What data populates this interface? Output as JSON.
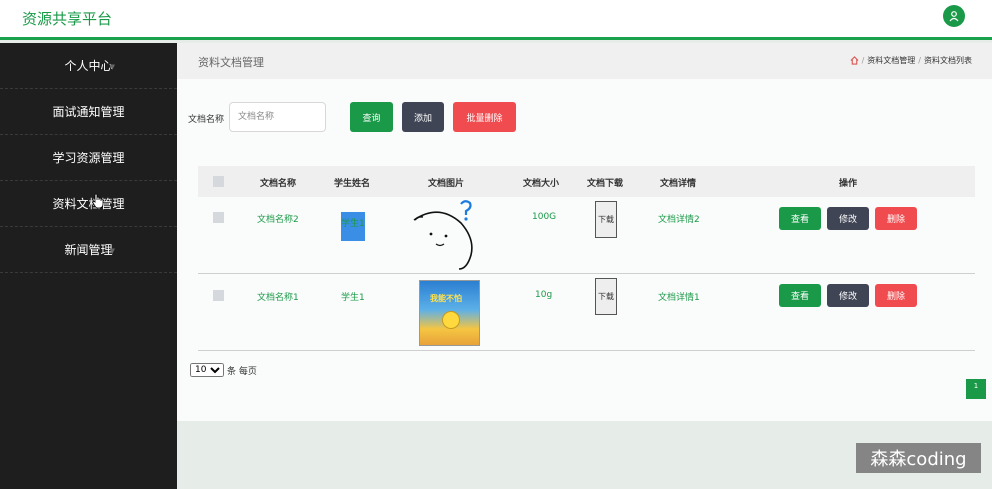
{
  "app": {
    "title": "资源共享平台"
  },
  "sidebar": {
    "items": [
      {
        "label": "个人中心",
        "has_arrow": true
      },
      {
        "label": "面试通知管理",
        "has_arrow": false
      },
      {
        "label": "学习资源管理",
        "has_arrow": false
      },
      {
        "label": "资料文档管理",
        "has_arrow": false
      },
      {
        "label": "新闻管理",
        "has_arrow": true
      }
    ]
  },
  "page": {
    "title": "资料文档管理",
    "breadcrumb": [
      "资料文档管理",
      "资料文档列表"
    ]
  },
  "search": {
    "label": "文档名称",
    "placeholder": "文档名称",
    "query_label": "查询",
    "add_label": "添加",
    "batch_delete_label": "批量删除"
  },
  "table": {
    "headers": [
      "文档名称",
      "学生姓名",
      "文档图片",
      "文档大小",
      "文档下载",
      "文档详情",
      "操作"
    ],
    "rows": [
      {
        "name": "文档名称2",
        "student": "学生1",
        "image": "doodle-face",
        "size": "100G",
        "download": "下载",
        "detail": "文档详情2"
      },
      {
        "name": "文档名称1",
        "student": "学生1",
        "image": "book-cover",
        "size": "10g",
        "download": "下载",
        "detail": "文档详情1",
        "image_text": "我能不怕"
      }
    ],
    "actions": {
      "view": "查看",
      "edit": "修改",
      "delete": "删除"
    }
  },
  "pagination": {
    "page_size": "10",
    "per_page_suffix": "条 每页",
    "current_page": "1"
  },
  "watermark": "森森coding",
  "colors": {
    "accent": "#1a9a48",
    "dark": "#3f4555",
    "danger": "#f04b4f",
    "sidebar": "#1e1e1e"
  }
}
